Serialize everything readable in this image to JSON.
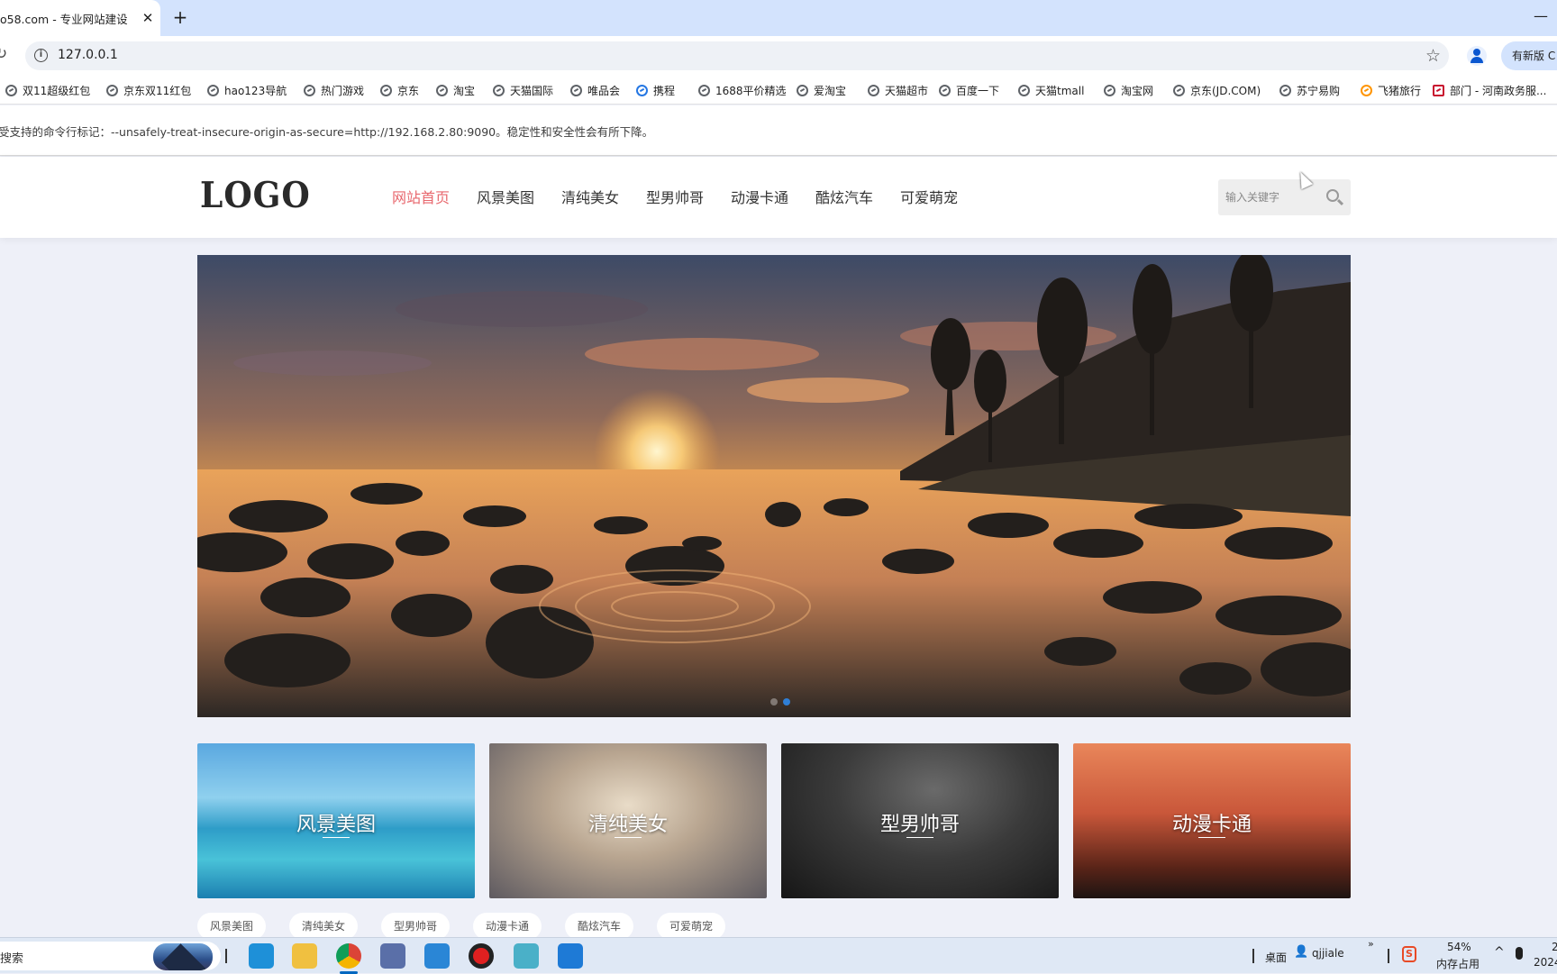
{
  "browser": {
    "tab_title": "o58.com - 专业网站建设 -",
    "tab_close": "✕",
    "new_tab": "+",
    "minimize": "—",
    "reload": "↻",
    "url": "127.0.0.1",
    "update_button": "有新版 C",
    "bookmarks": [
      {
        "label": "双11超级红包",
        "icon": "globe-icon"
      },
      {
        "label": "京东双11红包",
        "icon": "globe-icon"
      },
      {
        "label": "hao123导航",
        "icon": "globe-icon"
      },
      {
        "label": "热门游戏",
        "icon": "globe-icon"
      },
      {
        "label": "京东",
        "icon": "globe-icon"
      },
      {
        "label": "淘宝",
        "icon": "globe-icon"
      },
      {
        "label": "天猫国际",
        "icon": "globe-icon"
      },
      {
        "label": "唯品会",
        "icon": "globe-icon"
      },
      {
        "label": "携程",
        "icon": "ctrip-icon"
      },
      {
        "label": "1688平价精选",
        "icon": "globe-icon"
      },
      {
        "label": "爱淘宝",
        "icon": "globe-icon"
      },
      {
        "label": "天猫超市",
        "icon": "globe-icon"
      },
      {
        "label": "百度一下",
        "icon": "globe-icon"
      },
      {
        "label": "天猫tmall",
        "icon": "globe-icon"
      },
      {
        "label": "淘宝网",
        "icon": "globe-icon"
      },
      {
        "label": "京东(JD.COM)",
        "icon": "globe-icon"
      },
      {
        "label": "苏宁易购",
        "icon": "globe-icon"
      },
      {
        "label": "飞猪旅行",
        "icon": "fliggy-icon"
      },
      {
        "label": "部门 - 河南政务服...",
        "icon": "gov-icon"
      }
    ],
    "infobar_text": "受支持的命令行标记：--unsafely-treat-insecure-origin-as-secure=http://192.168.2.80:9090。稳定性和安全性会有所下降。"
  },
  "site": {
    "logo": "LOGO",
    "nav": [
      "网站首页",
      "风景美图",
      "清纯美女",
      "型男帅哥",
      "动漫卡通",
      "酷炫汽车",
      "可爱萌宠"
    ],
    "active_nav_color": "#e8676d",
    "search_placeholder": "输入关键字",
    "banner_dots": 2,
    "banner_active_dot": 1,
    "cards": [
      "风景美图",
      "清纯美女",
      "型男帅哥",
      "动漫卡通"
    ],
    "tags": [
      "风景美图",
      "清纯美女",
      "型男帅哥",
      "动漫卡通",
      "酷炫汽车",
      "可爱萌宠"
    ]
  },
  "taskbar": {
    "search_text": "搜索",
    "apps": [
      "edge-icon",
      "file-explorer-icon",
      "chrome-icon",
      "app-icon",
      "edge-icon",
      "record-icon",
      "notes-icon",
      "p-app-icon"
    ],
    "desktop_label": "桌面",
    "user_label": "qjjiale",
    "more": "»",
    "memory_percent": "54%",
    "memory_label": "内存占用",
    "clock_top": "2",
    "clock_bottom": "2024"
  }
}
